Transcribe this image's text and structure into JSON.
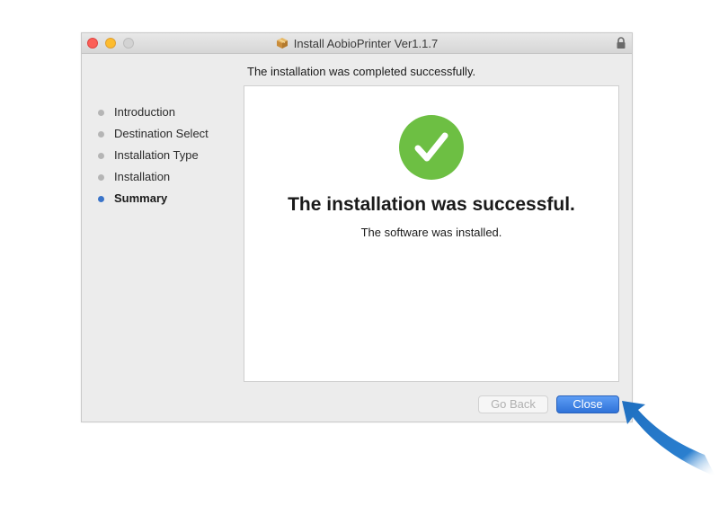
{
  "window": {
    "title": "Install AobioPrinter Ver1.1.7"
  },
  "header": {
    "message": "The installation was completed successfully."
  },
  "sidebar": {
    "items": [
      {
        "label": "Introduction",
        "active": false
      },
      {
        "label": "Destination Select",
        "active": false
      },
      {
        "label": "Installation Type",
        "active": false
      },
      {
        "label": "Installation",
        "active": false
      },
      {
        "label": "Summary",
        "active": true
      }
    ]
  },
  "panel": {
    "title": "The installation was successful.",
    "subtitle": "The software was installed.",
    "icon": "checkmark-circle-icon"
  },
  "buttons": {
    "back_label": "Go Back",
    "close_label": "Close"
  },
  "colors": {
    "success_green": "#6dbf43",
    "accent_blue": "#3a74c9",
    "annotation_arrow": "#1f6fc0"
  },
  "icons": {
    "title_icon": "package-icon",
    "lock_icon": "lock-icon",
    "annotation": "curved-arrow-icon"
  }
}
